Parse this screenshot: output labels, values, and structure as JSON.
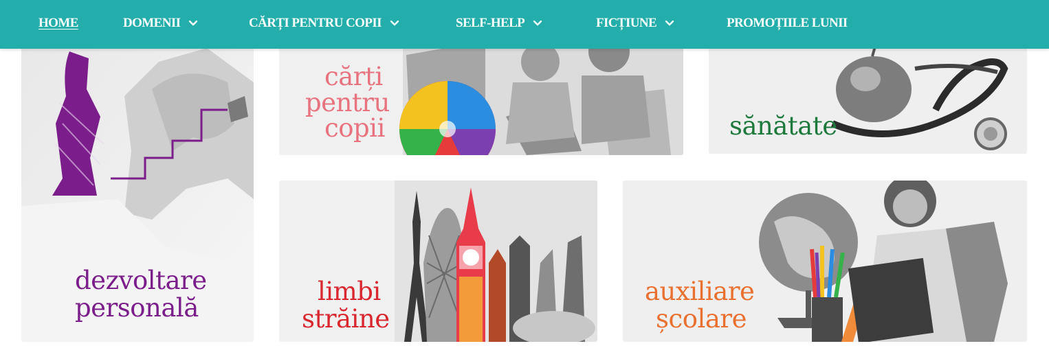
{
  "nav": {
    "items": [
      {
        "label": "HOME",
        "active": true,
        "dropdown": false
      },
      {
        "label": "DOMENII",
        "active": false,
        "dropdown": true
      },
      {
        "label": "CĂRȚI PENTRU COPII",
        "active": false,
        "dropdown": true
      },
      {
        "label": "SELF-HELP",
        "active": false,
        "dropdown": true
      },
      {
        "label": "FICȚIUNE",
        "active": false,
        "dropdown": true
      },
      {
        "label": "PROMOȚIILE LUNII",
        "active": false,
        "dropdown": false
      }
    ],
    "chevron_icon": "chevron-down-icon"
  },
  "colors": {
    "nav_background": "#23aeab",
    "nav_text": "#ffffff",
    "dezvoltare": "#7b1d8a",
    "copii": "#e8727e",
    "sanatate": "#1d7a3c",
    "limbi": "#d9262f",
    "auxiliare": "#ea7030"
  },
  "tiles": {
    "dezvoltare": {
      "line1": "dezvoltare",
      "line2": "personală"
    },
    "copii": {
      "line1": "cărți",
      "line2": "pentru",
      "line3": "copii"
    },
    "sanatate": {
      "line1": "sănătate"
    },
    "limbi": {
      "line1": "limbi",
      "line2": "străine"
    },
    "auxiliare": {
      "line1": "auxiliare",
      "line2": "școlare"
    }
  }
}
